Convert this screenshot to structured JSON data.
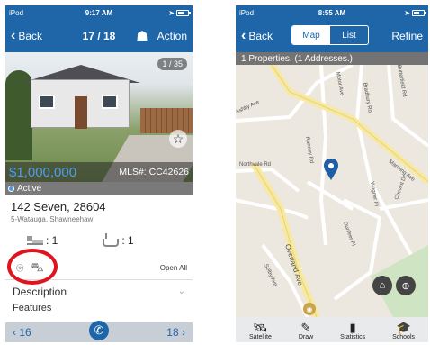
{
  "detail": {
    "status": {
      "carrier": "iPod",
      "time": "9:17 AM",
      "battery_level": 0.6
    },
    "nav": {
      "back_label": "Back",
      "counter": "17 / 18",
      "action_label": "Action"
    },
    "photo": {
      "counter": "1 / 35"
    },
    "price": "$1,000,000",
    "mls": "MLS#: CC42626",
    "status_label": "Active",
    "address_line1": "142 Seven, 28604",
    "address_line2": "5-Watauga, Shawneehaw",
    "beds": ": 1",
    "baths": ": 1",
    "open_all": "Open All",
    "section_description": "Description",
    "section_next": "Features",
    "prev_label": "16",
    "next_label": "18",
    "colors": {
      "nav": "#1f66a8",
      "price": "#4f9ee8",
      "highlight": "#e0141e"
    }
  },
  "map_screen": {
    "status": {
      "carrier": "iPod",
      "time": "8:55 AM",
      "battery_level": 0.6
    },
    "nav": {
      "back_label": "Back",
      "map_tab": "Map",
      "list_tab": "List",
      "refine_label": "Refine"
    },
    "summary": "1 Properties. (1 Addresses.)",
    "streets": [
      "Ashby Ave",
      "Northvale Rd",
      "Manning Ave",
      "Overland Ave",
      "Ranney Rd",
      "Bradbury Rd",
      "Dunleer Pl",
      "Selby Ave",
      "Motor Ave",
      "Cheviot Dr",
      "Butterfield Rd",
      "Wagner Pl"
    ],
    "tabs": [
      {
        "label": "Satellite",
        "icon": "satellite-icon"
      },
      {
        "label": "Draw",
        "icon": "pen-icon"
      },
      {
        "label": "Statistics",
        "icon": "bar-chart-icon"
      },
      {
        "label": "Schools",
        "icon": "graduation-cap-icon"
      }
    ]
  }
}
